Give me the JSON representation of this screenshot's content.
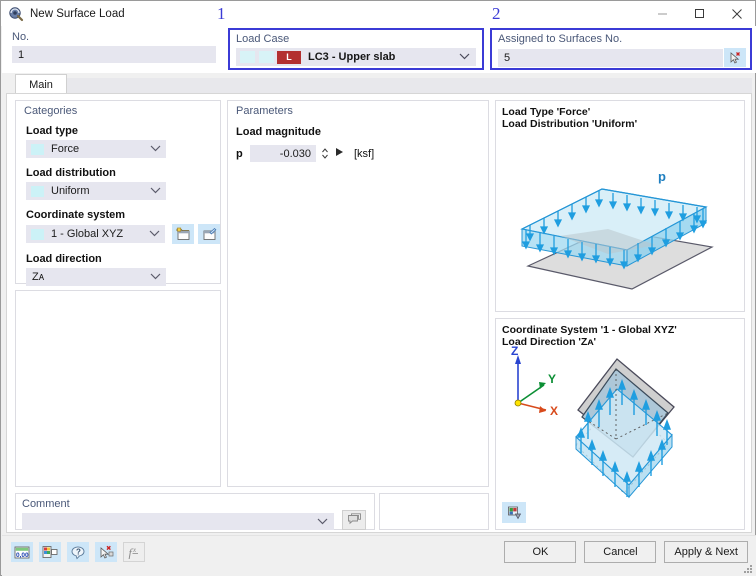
{
  "window": {
    "title": "New Surface Load",
    "icon": "app-icon",
    "controls": {
      "minimize": "minimize-icon",
      "maximize": "maximize-icon",
      "close": "close-icon"
    }
  },
  "callouts": {
    "one": "1",
    "two": "2"
  },
  "header": {
    "no": {
      "label": "No.",
      "value": "1"
    },
    "load_case": {
      "label": "Load Case",
      "value": "LC3 - Upper slab",
      "badge": "L",
      "badge_color": "#b33030",
      "swatch_color": "#d8f3f7"
    },
    "assigned": {
      "label": "Assigned to Surfaces No.",
      "value": "5",
      "picker_icon": "select-surfaces-icon"
    }
  },
  "tabs": [
    {
      "label": "Main",
      "active": true
    }
  ],
  "categories": {
    "title": "Categories",
    "fields": [
      {
        "label": "Load type",
        "value": "Force",
        "swatch": "#ccf2f7"
      },
      {
        "label": "Load distribution",
        "value": "Uniform",
        "swatch": "#ccf2f7"
      },
      {
        "label": "Coordinate system",
        "value": "1 - Global XYZ",
        "swatch": "#ccf2f7"
      },
      {
        "label": "Load direction",
        "value": "Zᴀ",
        "swatch": ""
      }
    ],
    "coord_buttons": [
      {
        "name": "new-coordinate-system-icon"
      },
      {
        "name": "edit-coordinate-system-icon"
      }
    ]
  },
  "parameters": {
    "title": "Parameters",
    "group_label": "Load magnitude",
    "symbol": "p",
    "value": "-0.030",
    "unit": "[ksf]",
    "spinner_icon": "spinner-updown-icon",
    "more_icon": "play-arrow-icon"
  },
  "preview_top": {
    "line1": "Load Type 'Force'",
    "line2": "Load Distribution 'Uniform'",
    "load_label": "p"
  },
  "preview_bottom": {
    "line1": "Coordinate System '1 - Global XYZ'",
    "line2": "Load Direction 'Zᴀ'",
    "axes": {
      "x": "X",
      "y": "Y",
      "z": "Z"
    },
    "render_button": "render-settings-icon"
  },
  "comment": {
    "label": "Comment",
    "value": "",
    "placeholder": "",
    "button_icon": "comment-library-icon"
  },
  "footer": {
    "tools": [
      {
        "name": "units-icon",
        "enabled": true
      },
      {
        "name": "graphics-icon",
        "enabled": true
      },
      {
        "name": "help-icon",
        "enabled": true
      },
      {
        "name": "load-wizard-icon",
        "enabled": true
      },
      {
        "name": "formula-icon",
        "enabled": false
      }
    ],
    "buttons": [
      {
        "label": "OK",
        "name": "ok-button"
      },
      {
        "label": "Cancel",
        "name": "cancel-button"
      },
      {
        "label": "Apply & Next",
        "name": "apply-next-button"
      }
    ]
  },
  "colors": {
    "accent_blue": "#3b3bd6",
    "field_bg": "#e6e6ef",
    "label_blue": "#4a5878",
    "arrow_blue": "#1f9ee0"
  }
}
